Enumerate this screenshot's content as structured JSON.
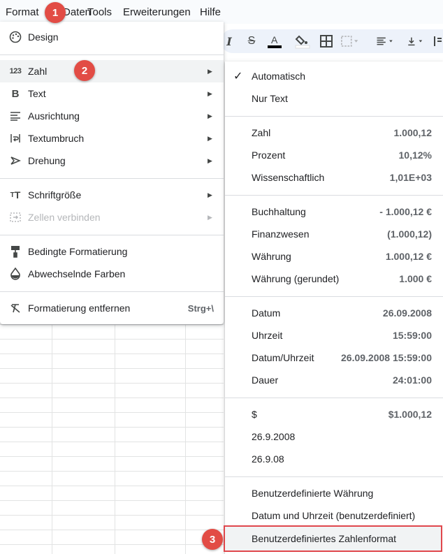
{
  "menubar": {
    "items": [
      "Format",
      "Daten",
      "Tools",
      "Erweiterungen",
      "Hilfe"
    ]
  },
  "badges": [
    "1",
    "2",
    "3"
  ],
  "format_menu": {
    "items": [
      {
        "label": "Design",
        "icon": "palette-icon"
      },
      {
        "label": "Zahl",
        "icon": "number-123-icon",
        "submenu": true
      },
      {
        "label": "Text",
        "icon": "bold-icon",
        "submenu": true
      },
      {
        "label": "Ausrichtung",
        "icon": "align-left-icon",
        "submenu": true
      },
      {
        "label": "Textumbruch",
        "icon": "text-wrap-icon",
        "submenu": true
      },
      {
        "label": "Drehung",
        "icon": "text-rotation-icon",
        "submenu": true
      },
      {
        "label": "Schriftgröße",
        "icon": "font-size-icon",
        "submenu": true
      },
      {
        "label": "Zellen verbinden",
        "icon": "merge-cells-icon",
        "submenu": true,
        "disabled": true
      },
      {
        "label": "Bedingte Formatierung",
        "icon": "paint-roller-icon"
      },
      {
        "label": "Abwechselnde Farben",
        "icon": "color-drop-icon"
      },
      {
        "label": "Formatierung entfernen",
        "icon": "clear-format-icon",
        "shortcut": "Strg+\\"
      }
    ]
  },
  "number_submenu": {
    "automatic": "Automatisch",
    "plain_text": "Nur Text",
    "group1": [
      {
        "label": "Zahl",
        "value": "1.000,12"
      },
      {
        "label": "Prozent",
        "value": "10,12%"
      },
      {
        "label": "Wissenschaftlich",
        "value": "1,01E+03"
      }
    ],
    "group2": [
      {
        "label": "Buchhaltung",
        "value": "- 1.000,12 €"
      },
      {
        "label": "Finanzwesen",
        "value": "(1.000,12)"
      },
      {
        "label": "Währung",
        "value": "1.000,12 €"
      },
      {
        "label": "Währung (gerundet)",
        "value": "1.000 €"
      }
    ],
    "group3": [
      {
        "label": "Datum",
        "value": "26.09.2008"
      },
      {
        "label": "Uhrzeit",
        "value": "15:59:00"
      },
      {
        "label": "Datum/Uhrzeit",
        "value": "26.09.2008 15:59:00"
      },
      {
        "label": "Dauer",
        "value": "24:01:00"
      }
    ],
    "group4": [
      {
        "label": "$",
        "value": "$1.000,12"
      },
      {
        "label": "26.9.2008",
        "value": ""
      },
      {
        "label": "26.9.08",
        "value": ""
      }
    ],
    "custom": [
      "Benutzerdefinierte Währung",
      "Datum und Uhrzeit (benutzerdefiniert)",
      "Benutzerdefiniertes Zahlenformat"
    ]
  },
  "colors": {
    "badge": "#e24c45",
    "highlight_border": "#e0474c",
    "text_color_bar": "#000000"
  }
}
